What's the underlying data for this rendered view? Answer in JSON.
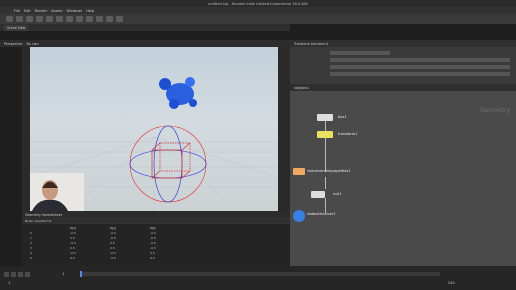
{
  "window": {
    "title": "untitled.hip - Houdini Indie Limited-Commercial 18.0.460"
  },
  "menu": [
    "File",
    "Edit",
    "Render",
    "Assets",
    "Windows",
    "Help"
  ],
  "viewer": {
    "tab_label": "Scene View",
    "camera": "Perspective",
    "no_cam": "No cam"
  },
  "spreadsheet": {
    "tab": "Geometry Spreadsheet",
    "node": "Node: transform1",
    "columns": [
      "",
      "P[x]",
      "P[y]",
      "P[z]"
    ],
    "rows": [
      [
        "0",
        "-0.5",
        "-0.5",
        "-0.5"
      ],
      [
        "1",
        "0.5",
        "-0.5",
        "-0.5"
      ],
      [
        "2",
        "-0.5",
        "0.5",
        "-0.5"
      ],
      [
        "3",
        "0.5",
        "0.5",
        "-0.5"
      ],
      [
        "4",
        "-0.5",
        "-0.5",
        "0.5"
      ],
      [
        "5",
        "0.5",
        "-0.5",
        "0.5"
      ]
    ]
  },
  "network": {
    "path": "/obj/geo1",
    "context_label": "Geometry",
    "nodes": {
      "box": "box1",
      "transform": "transform1",
      "constraint": "rbdconstraintproperties1",
      "null": "null1",
      "bullet": "rbdbulletsolver1"
    }
  },
  "params": {
    "header": "Transform transform1"
  },
  "timeline": {
    "start": "1",
    "end": "240",
    "current": "1"
  },
  "colors": {
    "node_yellow": "#e8e060",
    "node_orange": "#f0a860",
    "node_blue": "#3a7ee0",
    "fish_blue": "#2a5fe0"
  }
}
